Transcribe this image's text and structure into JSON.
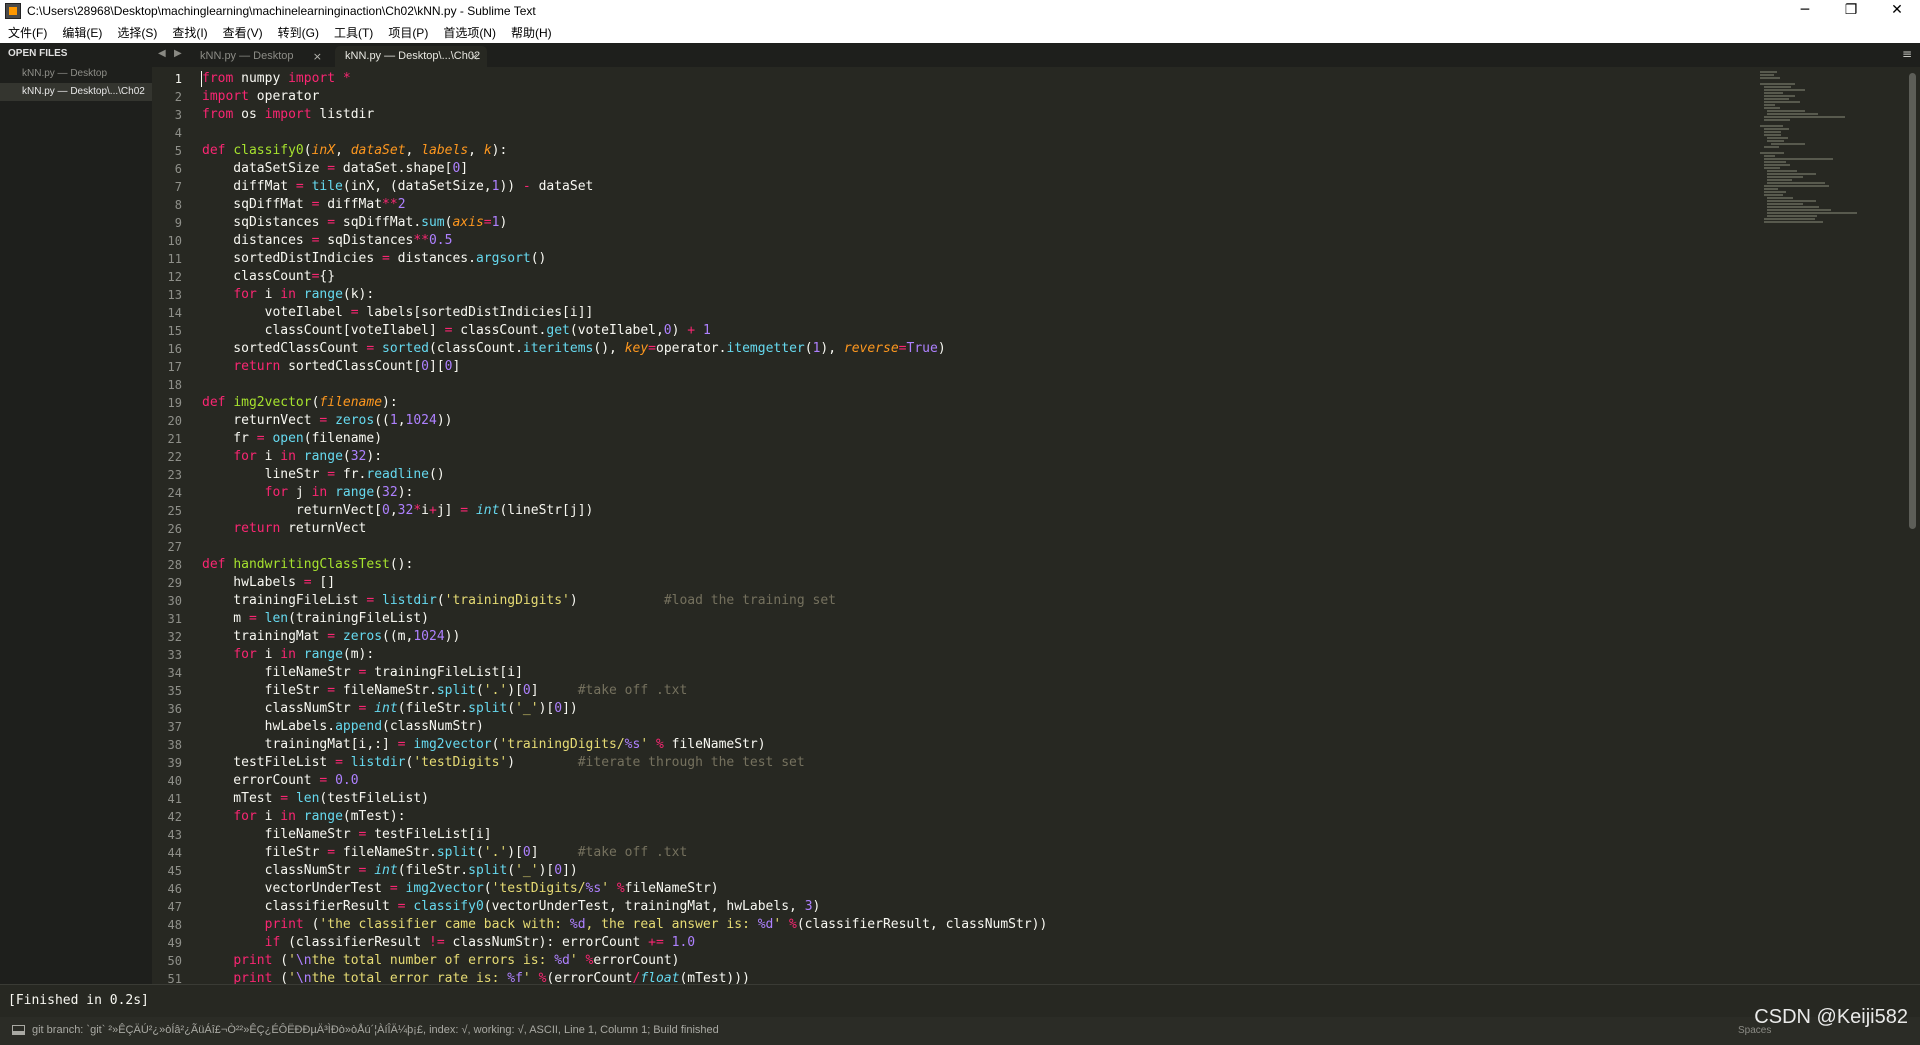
{
  "window": {
    "title": "C:\\Users\\28968\\Desktop\\machinglearning\\machinelearninginaction\\Ch02\\kNN.py - Sublime Text",
    "controls": [
      "─",
      "❐",
      "✕"
    ]
  },
  "menu": [
    "文件(F)",
    "编辑(E)",
    "选择(S)",
    "查找(I)",
    "查看(V)",
    "转到(G)",
    "工具(T)",
    "项目(P)",
    "首选项(N)",
    "帮助(H)"
  ],
  "sidebar": {
    "header": "OPEN FILES",
    "files": [
      "kNN.py — Desktop",
      "kNN.py — Desktop\\...\\Ch02"
    ]
  },
  "tabs": [
    {
      "label": "kNN.py — Desktop",
      "close": "×",
      "active": false
    },
    {
      "label": "kNN.py — Desktop\\...\\Ch02",
      "close": "×",
      "active": true
    }
  ],
  "tab_arrows": [
    "◀",
    "▶"
  ],
  "tab_menu_icon": "≡",
  "editor": {
    "current_line": 1,
    "syntax_colors": {
      "background": "#272822",
      "keyword": "#f92672",
      "function": "#a6e22e",
      "builtin": "#66d9ef",
      "parameter": "#fd971f",
      "number": "#ae81ff",
      "string": "#e6db74",
      "comment": "#75715e"
    },
    "lines": [
      "from numpy import *",
      "import operator",
      "from os import listdir",
      "",
      "def classify0(inX, dataSet, labels, k):",
      "    dataSetSize = dataSet.shape[0]",
      "    diffMat = tile(inX, (dataSetSize,1)) - dataSet",
      "    sqDiffMat = diffMat**2",
      "    sqDistances = sqDiffMat.sum(axis=1)",
      "    distances = sqDistances**0.5",
      "    sortedDistIndicies = distances.argsort()",
      "    classCount={}",
      "    for i in range(k):",
      "        voteIlabel = labels[sortedDistIndicies[i]]",
      "        classCount[voteIlabel] = classCount.get(voteIlabel,0) + 1",
      "    sortedClassCount = sorted(classCount.iteritems(), key=operator.itemgetter(1), reverse=True)",
      "    return sortedClassCount[0][0]",
      "",
      "def img2vector(filename):",
      "    returnVect = zeros((1,1024))",
      "    fr = open(filename)",
      "    for i in range(32):",
      "        lineStr = fr.readline()",
      "        for j in range(32):",
      "            returnVect[0,32*i+j] = int(lineStr[j])",
      "    return returnVect",
      "",
      "def handwritingClassTest():",
      "    hwLabels = []",
      "    trainingFileList = listdir('trainingDigits')           #load the training set",
      "    m = len(trainingFileList)",
      "    trainingMat = zeros((m,1024))",
      "    for i in range(m):",
      "        fileNameStr = trainingFileList[i]",
      "        fileStr = fileNameStr.split('.')[0]     #take off .txt",
      "        classNumStr = int(fileStr.split('_')[0])",
      "        hwLabels.append(classNumStr)",
      "        trainingMat[i,:] = img2vector('trainingDigits/%s' % fileNameStr)",
      "    testFileList = listdir('testDigits')        #iterate through the test set",
      "    errorCount = 0.0",
      "    mTest = len(testFileList)",
      "    for i in range(mTest):",
      "        fileNameStr = testFileList[i]",
      "        fileStr = fileNameStr.split('.')[0]     #take off .txt",
      "        classNumStr = int(fileStr.split('_')[0])",
      "        vectorUnderTest = img2vector('testDigits/%s' %fileNameStr)",
      "        classifierResult = classify0(vectorUnderTest, trainingMat, hwLabels, 3)",
      "        print ('the classifier came back with: %d, the real answer is: %d' %(classifierResult, classNumStr))",
      "        if (classifierResult != classNumStr): errorCount += 1.0",
      "    print ('\\nthe total number of errors is: %d' %errorCount)",
      "    print ('\\nthe total error rate is: %f' %(errorCount/float(mTest)))"
    ]
  },
  "build_output": "[Finished in 0.2s]",
  "statusbar": {
    "text": "git branch: `git` ²»ÊÇÄÚ²¿»òÍâ²¿ÃüÁî£¬Ò²²»ÊÇ¿ÉÔËÐÐµÄ³ÌÐò»òÅú´¦ÀíÎÄ¼þ¡£, index: √, working: √, ASCII, Line 1, Column 1; Build finished",
    "right": "Spaces"
  },
  "watermark": "CSDN @Keiji582"
}
